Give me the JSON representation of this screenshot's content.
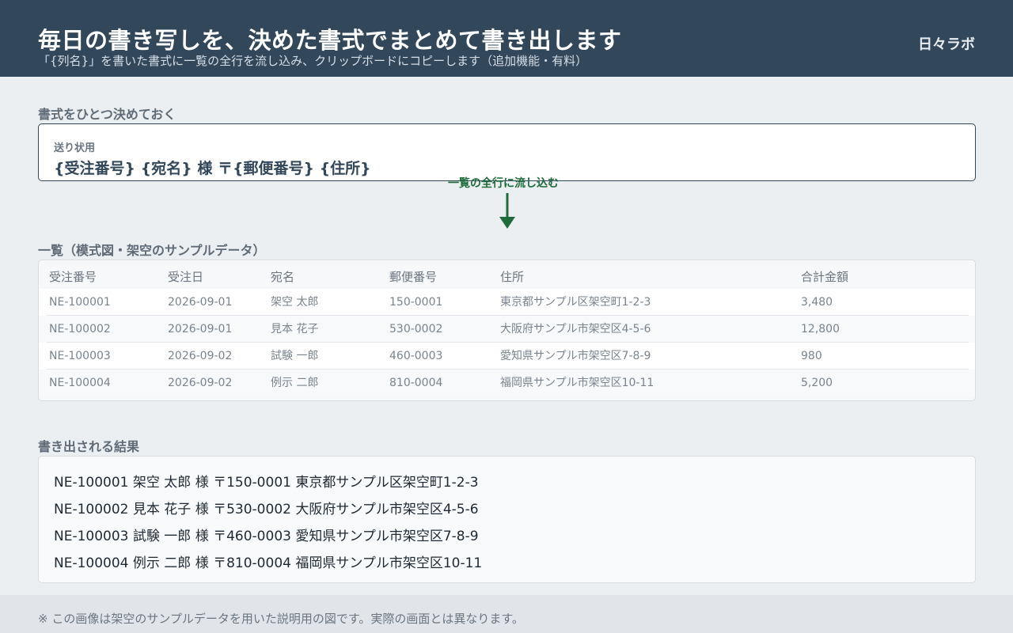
{
  "header": {
    "title": "毎日の書き写しを、決めた書式でまとめて書き出します",
    "subtitle": "「{列名}」を書いた書式に一覧の全行を流し込み、クリップボードにコピーします（追加機能・有料）",
    "brand": "日々ラボ"
  },
  "format_section": {
    "label": "書式をひとつ決めておく",
    "caption": "送り状用",
    "template": "{受注番号} {宛名} 様  〒{郵便番号} {住所}"
  },
  "arrow": {
    "label": "一覧の全行に流し込む",
    "color": "#1e6b3b",
    "icon": "arrow-down-icon"
  },
  "table_section": {
    "label": "一覧（模式図・架空のサンプルデータ）",
    "columns": [
      "受注番号",
      "受注日",
      "宛名",
      "郵便番号",
      "住所",
      "合計金額"
    ],
    "rows": [
      [
        "NE-100001",
        "2026-09-01",
        "架空 太郎",
        "150-0001",
        "東京都サンプル区架空町1-2-3",
        "3,480"
      ],
      [
        "NE-100002",
        "2026-09-01",
        "見本 花子",
        "530-0002",
        "大阪府サンプル市架空区4-5-6",
        "12,800"
      ],
      [
        "NE-100003",
        "2026-09-02",
        "試験 一郎",
        "460-0003",
        "愛知県サンプル市架空区7-8-9",
        "980"
      ],
      [
        "NE-100004",
        "2026-09-02",
        "例示 二郎",
        "810-0004",
        "福岡県サンプル市架空区10-11",
        "5,200"
      ]
    ]
  },
  "result_section": {
    "label": "書き出される結果",
    "lines": [
      "NE-100001  架空 太郎 様  〒150-0001 東京都サンプル区架空町1-2-3",
      "NE-100002  見本 花子 様  〒530-0002 大阪府サンプル市架空区4-5-6",
      "NE-100003  試験 一郎 様  〒460-0003 愛知県サンプル市架空区7-8-9",
      "NE-100004  例示 二郎 様  〒810-0004 福岡県サンプル市架空区10-11"
    ]
  },
  "footer": {
    "note": "※ この画像は架空のサンプルデータを用いた説明用の図です。実際の画面とは異なります。"
  },
  "colors": {
    "header_bg": "#33475b",
    "accent_green": "#1e6b3b",
    "page_bg": "#eceff2"
  }
}
